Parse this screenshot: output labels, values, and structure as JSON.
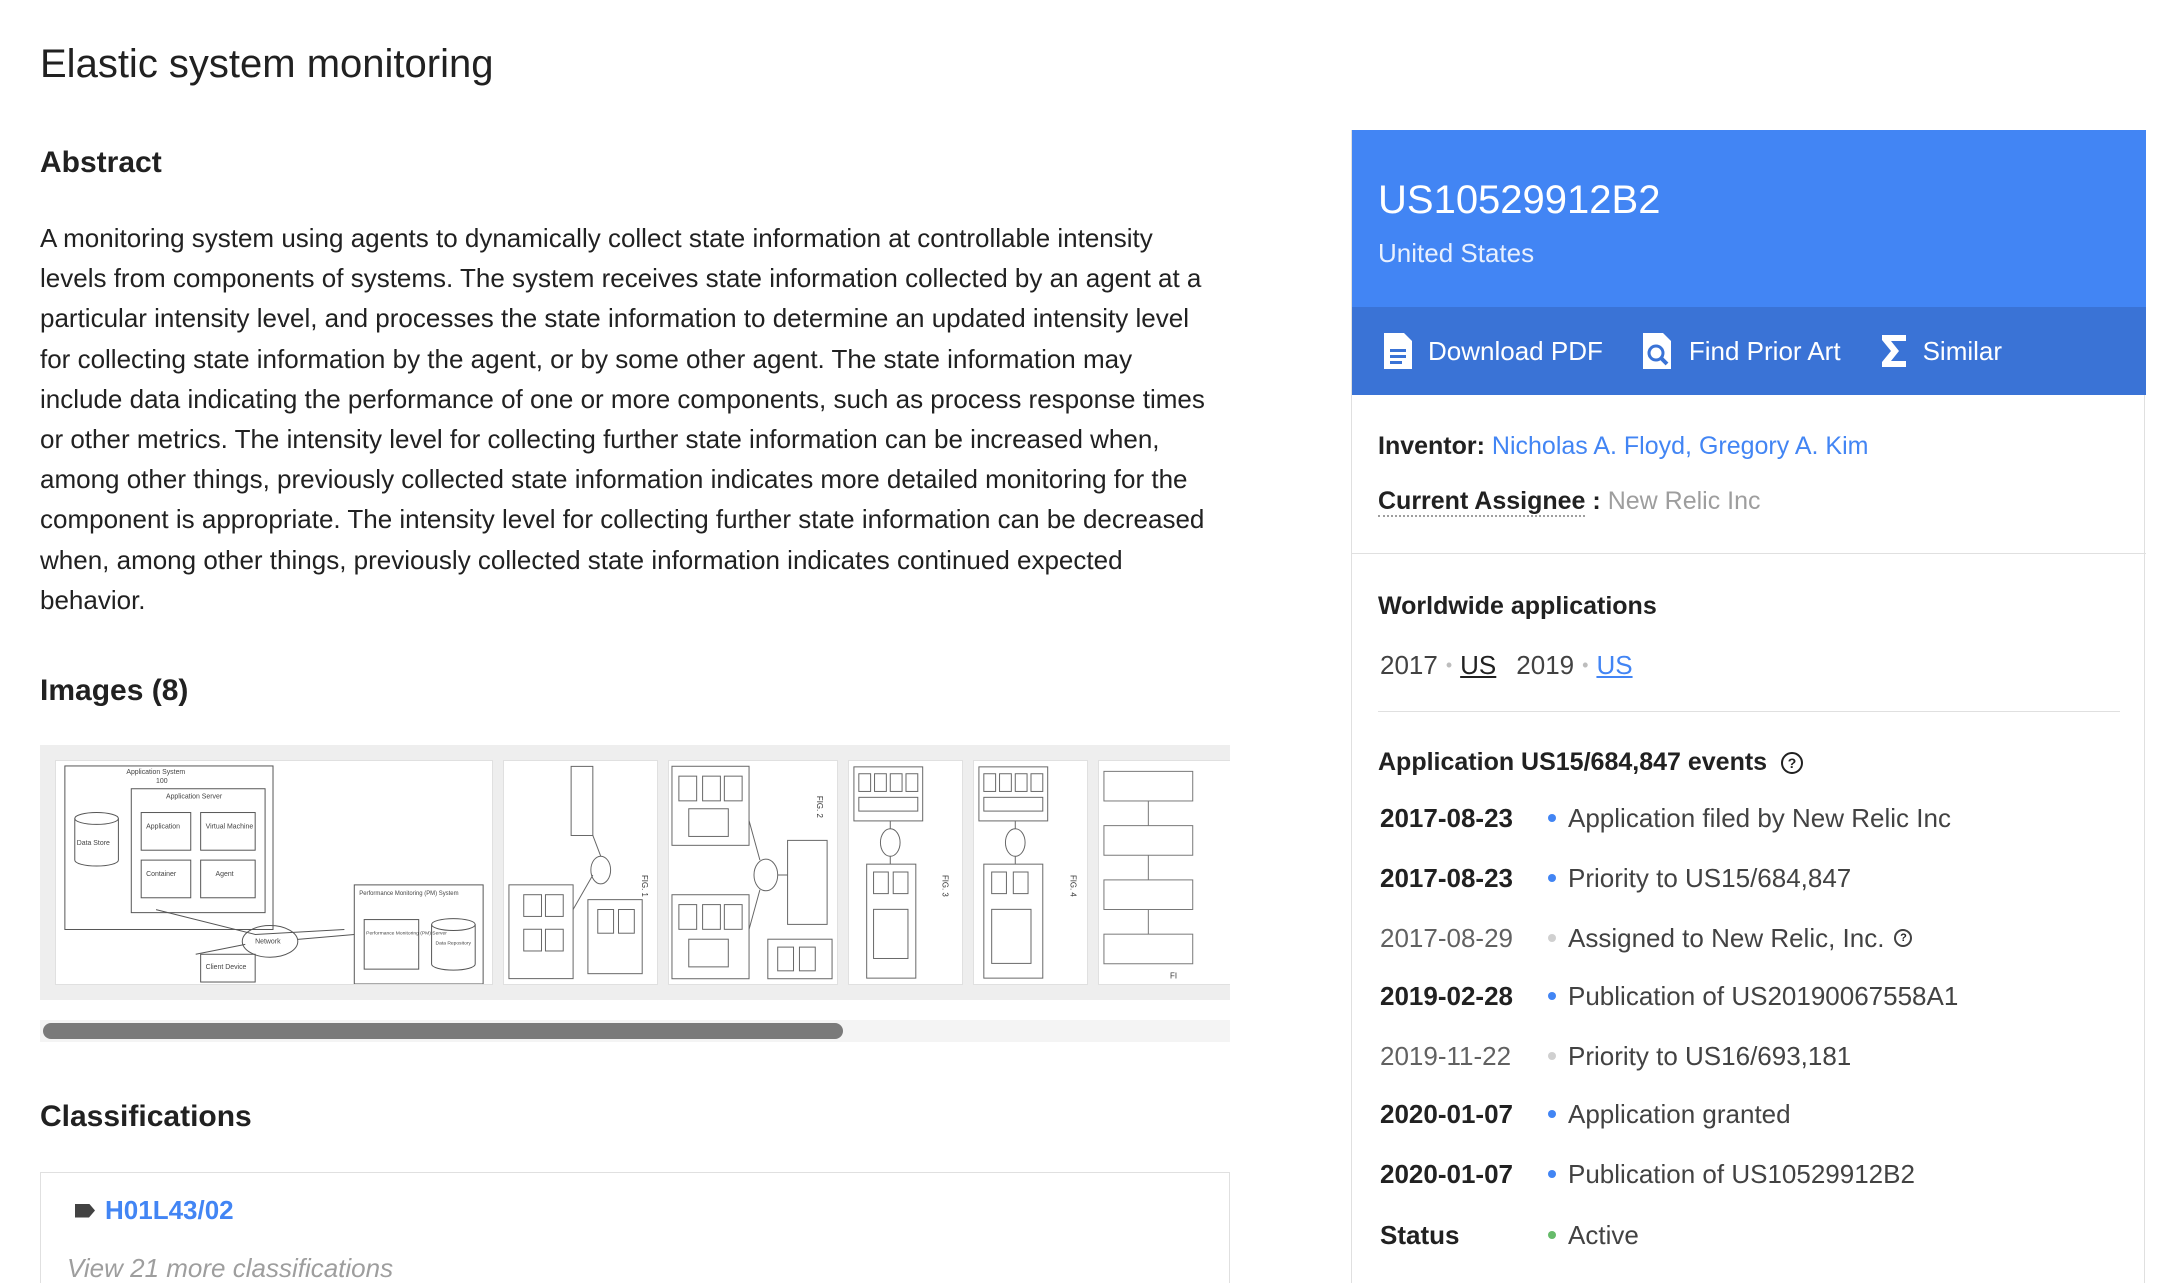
{
  "title": "Elastic system monitoring",
  "abstract": {
    "heading": "Abstract",
    "text": "A monitoring system using agents to dynamically collect state information at controllable intensity levels from components of systems. The system receives state information collected by an agent at a particular intensity level, and processes the state information to determine an updated intensity level for collecting state information by the agent, or by some other agent. The state information may include data indicating the performance of one or more components, such as process response times or other metrics. The intensity level for collecting further state information can be increased when, among other things, previously collected state information indicates more detailed monitoring for the component is appropriate. The intensity level for collecting further state information can be decreased when, among other things, previously collected state information indicates continued expected behavior."
  },
  "images": {
    "heading": "Images (8)",
    "thumb1_labels": [
      "Application System",
      "100",
      "Application Server",
      "Application",
      "Virtual Machine",
      "Data Store",
      "Container",
      "Agent",
      "Network",
      "Client Device",
      "Performance Monitoring (PM) System",
      "Performance Monitoring (PM) Server",
      "Data Repository"
    ],
    "fig_labels": [
      "FIG. 1",
      "FIG. 2",
      "FIG. 3",
      "FIG. 4",
      "FI"
    ]
  },
  "classifications": {
    "heading": "Classifications",
    "code": "H01L43/02",
    "more": "View 21 more classifications"
  },
  "patent": {
    "number": "US10529912B2",
    "country": "United States",
    "actions": {
      "download": "Download PDF",
      "prior_art": "Find Prior Art",
      "similar": "Similar"
    },
    "inventor_label": "Inventor:",
    "inventors": [
      "Nicholas A. Floyd",
      "Gregory A. Kim"
    ],
    "inventor_sep": ",",
    "assignee_label": "Current Assignee",
    "assignee_colon": ":",
    "assignee": "New Relic Inc",
    "worldwide": {
      "heading": "Worldwide applications",
      "entries": [
        {
          "year": "2017",
          "country": "US"
        },
        {
          "year": "2019",
          "country": "US"
        }
      ],
      "dot": "•"
    },
    "events_heading": "Application US15/684,847 events",
    "help_glyph": "?",
    "events": [
      {
        "date": "2017-08-23",
        "text": "Application filed by New Relic Inc"
      },
      {
        "date": "2017-08-23",
        "text": "Priority to US15/684,847"
      },
      {
        "date": "2017-08-29",
        "text": "Assigned to New Relic, Inc."
      },
      {
        "date": "2019-02-28",
        "text": "Publication of US20190067558A1"
      },
      {
        "date": "2019-11-22",
        "text": "Priority to US16/693,181"
      },
      {
        "date": "2020-01-07",
        "text": "Application granted"
      },
      {
        "date": "2020-01-07",
        "text": "Publication of US10529912B2"
      }
    ],
    "status_label": "Status",
    "status_value": "Active",
    "colors": {
      "accent": "#4285f4",
      "accent_dark": "#3a73d6",
      "active": "#66bb6a"
    },
    "icons": [
      "pdf-document-icon",
      "magnifier-document-icon",
      "sigma-icon",
      "help-circle-icon",
      "tag-icon"
    ]
  }
}
